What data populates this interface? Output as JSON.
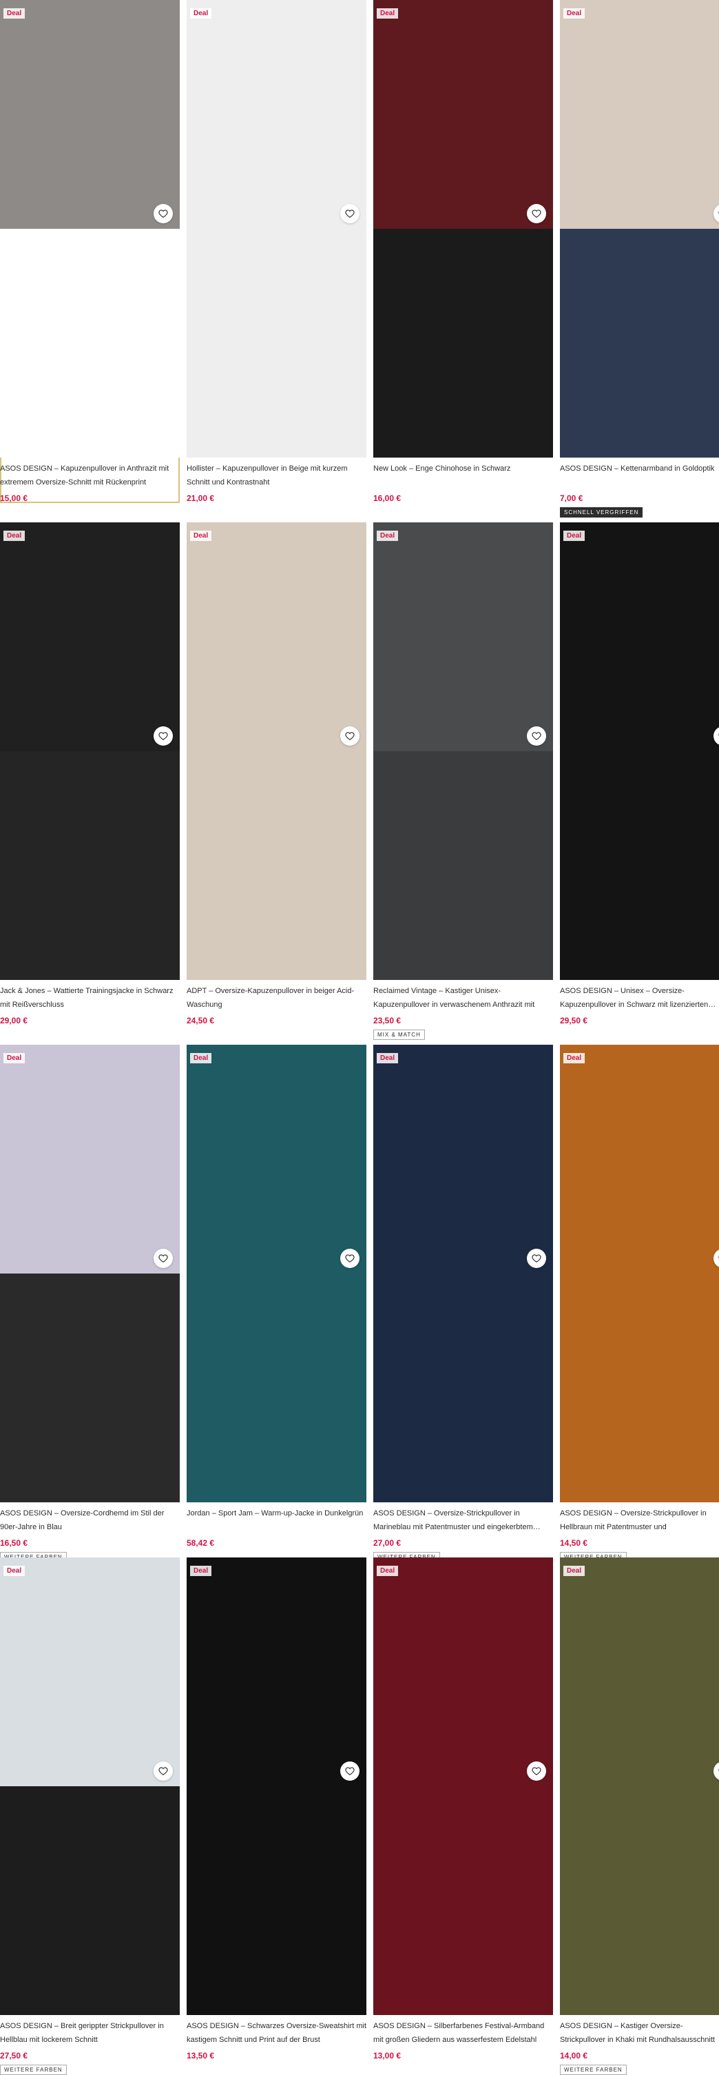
{
  "deal_label": "Deal",
  "products": [
    {
      "title": "ASOS DESIGN – Kapuzenpullover in Anthrazit mit extremem Oversize-Schnitt mit Rückenprint",
      "price": "15,00 €",
      "deal": true,
      "tag": "",
      "selected": true,
      "bg1": "#8d8a88",
      "bg2": "#ffffff"
    },
    {
      "title": "Hollister – Kapuzenpullover in Beige mit kurzem Schnitt und Kontrastnaht",
      "price": "21,00 €",
      "deal": true,
      "tag": "",
      "selected": false,
      "bg1": "#eeeeee",
      "bg2": "#eeeeee"
    },
    {
      "title": "New Look – Enge Chinohose in Schwarz",
      "price": "16,00 €",
      "deal": true,
      "tag": "",
      "selected": false,
      "bg1": "#5e1a1f",
      "bg2": "#1b1b1b"
    },
    {
      "title": "ASOS DESIGN – Kettenarmband in Goldoptik",
      "price": "7,00 €",
      "deal": true,
      "tag": "SCHNELL VERGRIFFEN",
      "selected": false,
      "bg1": "#d7cabe",
      "bg2": "#2d3a52"
    },
    {
      "title": "Jack & Jones – Wattierte Trainingsjacke in Schwarz mit Reißverschluss",
      "price": "29,00 €",
      "deal": true,
      "tag": "",
      "selected": false,
      "bg1": "#202020",
      "bg2": "#252525"
    },
    {
      "title": "ADPT – Oversize-Kapuzenpullover in beiger Acid-Waschung",
      "price": "24,50 €",
      "deal": true,
      "tag": "",
      "selected": false,
      "bg1": "#d6cabc",
      "bg2": "#d6cabc"
    },
    {
      "title": "Reclaimed Vintage – Kastiger Unisex-Kapuzenpullover in verwaschenem Anthrazit mit",
      "price": "23,50 €",
      "deal": true,
      "tag": "MIX & MATCH",
      "selected": false,
      "bg1": "#4a4b4d",
      "bg2": "#3b3c3e"
    },
    {
      "title": "ASOS DESIGN – Unisex – Oversize-Kapuzenpullover in Schwarz mit lizenzierten…",
      "price": "29,50 €",
      "deal": true,
      "tag": "",
      "selected": false,
      "bg1": "#141414",
      "bg2": "#141414"
    },
    {
      "title": "ASOS DESIGN – Oversize-Cordhemd im Stil der 90er-Jahre in Blau",
      "price": "16,50 €",
      "deal": true,
      "tag": "WEITERE FARBEN",
      "selected": false,
      "bg1": "#c9c4d6",
      "bg2": "#2a2a2a"
    },
    {
      "title": "Jordan – Sport Jam – Warm-up-Jacke in Dunkelgrün",
      "price": "58,42 €",
      "deal": true,
      "tag": "",
      "selected": false,
      "bg1": "#1e5b63",
      "bg2": "#1e5b63"
    },
    {
      "title": "ASOS DESIGN – Oversize-Strickpullover in Marineblau mit Patentmuster und eingekerbtem…",
      "price": "27,00 €",
      "deal": true,
      "tag": "WEITERE FARBEN",
      "selected": false,
      "bg1": "#1c2a44",
      "bg2": "#1c2a44"
    },
    {
      "title": "ASOS DESIGN – Oversize-Strickpullover in Hellbraun mit Patentmuster und eingekerbtem…",
      "price": "14,50 €",
      "deal": true,
      "tag": "WEITERE FARBEN",
      "selected": false,
      "bg1": "#b6651f",
      "bg2": "#b6651f"
    },
    {
      "title": "ASOS DESIGN – Breit gerippter Strickpullover in Hellblau mit lockerem Schnitt",
      "price": "27,50 €",
      "deal": true,
      "tag": "WEITERE FARBEN",
      "selected": false,
      "bg1": "#d8dee2",
      "bg2": "#1d1d1d"
    },
    {
      "title": "ASOS DESIGN – Schwarzes Oversize-Sweatshirt mit kastigem Schnitt und Print auf der Brust",
      "price": "13,50 €",
      "deal": true,
      "tag": "",
      "selected": false,
      "bg1": "#111111",
      "bg2": "#111111"
    },
    {
      "title": "ASOS DESIGN – Silberfarbenes Festival-Armband mit großen Gliedern aus wasserfestem Edelstahl",
      "price": "13,00 €",
      "deal": true,
      "tag": "",
      "selected": false,
      "bg1": "#6b1420",
      "bg2": "#6b1420"
    },
    {
      "title": "ASOS DESIGN – Kastiger Oversize-Strickpullover in Khaki mit Rundhalsausschnitt und gerippten Ärmeln",
      "price": "14,00 €",
      "deal": true,
      "tag": "WEITERE FARBEN",
      "selected": false,
      "bg1": "#5a5a34",
      "bg2": "#5a5a34"
    }
  ]
}
